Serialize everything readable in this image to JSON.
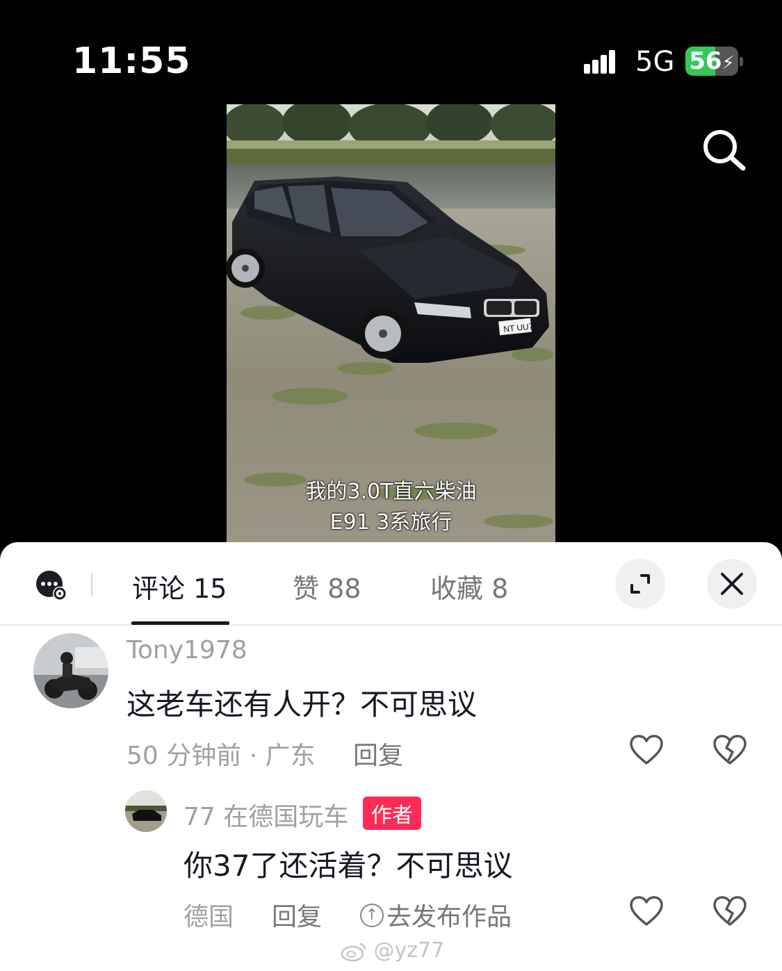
{
  "status_bar": {
    "time": "11:55",
    "network": "5G",
    "battery": "56",
    "battery_level": 0.56
  },
  "video": {
    "caption_line1": "我的3.0T直六柴油",
    "caption_line2": "E91 3系旅行",
    "plate": "NT UU7"
  },
  "tabs": [
    {
      "label": "评论 15"
    },
    {
      "label": "赞 88"
    },
    {
      "label": "收藏 8"
    }
  ],
  "comments": [
    {
      "username": "Tony1978",
      "text": "这老车还有人开？不可思议",
      "meta": "50 分钟前 · 广东",
      "reply_label": "回复"
    }
  ],
  "reply": {
    "username": "77 在德国玩车",
    "badge": "作者",
    "text": "你37了还活着？不可思议",
    "meta": "德国",
    "reply_label": "回复",
    "publish_label": "去发布作品"
  },
  "watermark": "@yz77",
  "colors": {
    "accent": "#fe2c55",
    "battery": "#34c759"
  }
}
